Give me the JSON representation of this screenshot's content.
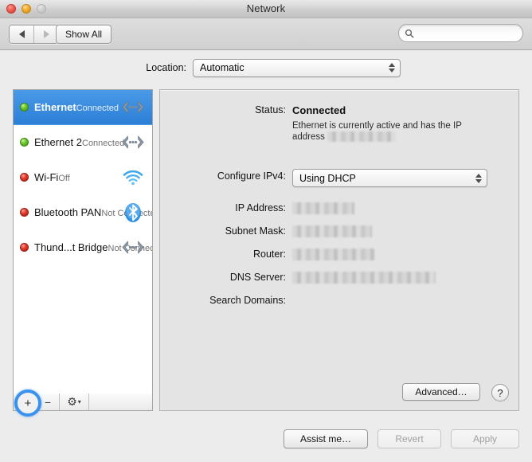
{
  "window": {
    "title": "Network",
    "traffic_lights": [
      "close",
      "minimize",
      "zoom"
    ]
  },
  "toolbar": {
    "back_icon": "triangle-left-icon",
    "forward_icon": "triangle-right-icon",
    "show_all_label": "Show All",
    "search_placeholder": "",
    "search_value": "",
    "search_icon": "magnifier-icon"
  },
  "location": {
    "label": "Location:",
    "selected": "Automatic"
  },
  "sidebar": {
    "services": [
      {
        "name": "Ethernet",
        "status": "Connected",
        "dot": "green",
        "icon": "ethernet-icon",
        "selected": true
      },
      {
        "name": "Ethernet 2",
        "status": "Connected",
        "dot": "green",
        "icon": "ethernet-icon",
        "selected": false
      },
      {
        "name": "Wi-Fi",
        "status": "Off",
        "dot": "red",
        "icon": "wifi-icon",
        "selected": false
      },
      {
        "name": "Bluetooth PAN",
        "status": "Not Connected",
        "dot": "red",
        "icon": "bluetooth-icon",
        "selected": false
      },
      {
        "name": "Thund...t Bridge",
        "status": "Not Connected",
        "dot": "red",
        "icon": "ethernet-icon",
        "selected": false
      }
    ],
    "toolbar": {
      "add_label": "+",
      "remove_label": "−",
      "gear_label": "⚙",
      "gear_caret": "▾"
    }
  },
  "panel": {
    "status_label": "Status:",
    "status_value": "Connected",
    "status_description_prefix": "Ethernet is currently active and has the IP address ",
    "status_description_redacted": true,
    "configure_ipv4_label": "Configure IPv4:",
    "configure_ipv4_value": "Using DHCP",
    "fields": [
      {
        "label": "IP Address:",
        "value": "",
        "redacted": true,
        "redact_width": 78
      },
      {
        "label": "Subnet Mask:",
        "value": "",
        "redacted": true,
        "redact_width": 100
      },
      {
        "label": "Router:",
        "value": "",
        "redacted": true,
        "redact_width": 103
      },
      {
        "label": "DNS Server:",
        "value": "",
        "redacted": true,
        "redact_width": 180
      },
      {
        "label": "Search Domains:",
        "value": "",
        "redacted": false,
        "redact_width": 0
      }
    ],
    "advanced_label": "Advanced…",
    "help_label": "?"
  },
  "footer": {
    "assist_label": "Assist me…",
    "revert_label": "Revert",
    "revert_enabled": false,
    "apply_label": "Apply",
    "apply_enabled": false
  },
  "colors": {
    "accent": "#3b92ec",
    "selection": "#2c7fd6",
    "connected": "#6ec72e",
    "disconnected": "#e0392a",
    "panel_bg": "#e4e4e4",
    "window_bg": "#ececec"
  }
}
